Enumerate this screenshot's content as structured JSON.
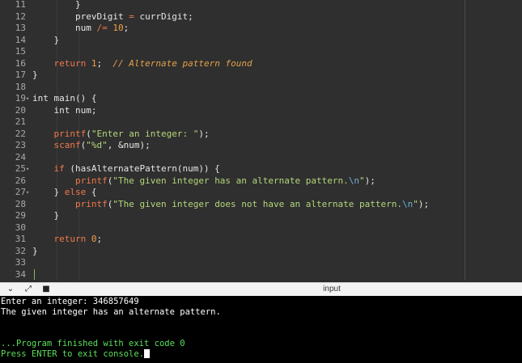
{
  "editor": {
    "line_numbers": [
      "11",
      "12",
      "13",
      "14",
      "15",
      "16",
      "17",
      "18",
      "19",
      "20",
      "21",
      "22",
      "23",
      "24",
      "25",
      "26",
      "27",
      "28",
      "29",
      "30",
      "31",
      "32",
      "33",
      "34"
    ],
    "folded_lines": [
      "19",
      "25",
      "27"
    ],
    "lines": [
      [
        {
          "t": "        }",
          "c": ""
        }
      ],
      [
        {
          "t": "        prevDigit ",
          "c": ""
        },
        {
          "t": "=",
          "c": "op"
        },
        {
          "t": " currDigit;",
          "c": ""
        }
      ],
      [
        {
          "t": "        num ",
          "c": ""
        },
        {
          "t": "/=",
          "c": "op"
        },
        {
          "t": " ",
          "c": ""
        },
        {
          "t": "10",
          "c": "num"
        },
        {
          "t": ";",
          "c": ""
        }
      ],
      [
        {
          "t": "    }",
          "c": ""
        }
      ],
      [
        {
          "t": "",
          "c": ""
        }
      ],
      [
        {
          "t": "    ",
          "c": ""
        },
        {
          "t": "return",
          "c": "fn"
        },
        {
          "t": " ",
          "c": ""
        },
        {
          "t": "1",
          "c": "num"
        },
        {
          "t": ";  ",
          "c": ""
        },
        {
          "t": "// Alternate pattern found",
          "c": "cmt"
        }
      ],
      [
        {
          "t": "}",
          "c": ""
        }
      ],
      [
        {
          "t": "",
          "c": ""
        }
      ],
      [
        {
          "t": "int main() {",
          "c": ""
        }
      ],
      [
        {
          "t": "    int num;",
          "c": ""
        }
      ],
      [
        {
          "t": "",
          "c": ""
        }
      ],
      [
        {
          "t": "    ",
          "c": ""
        },
        {
          "t": "printf",
          "c": "fn"
        },
        {
          "t": "(",
          "c": ""
        },
        {
          "t": "\"Enter an integer: \"",
          "c": "str"
        },
        {
          "t": ");",
          "c": ""
        }
      ],
      [
        {
          "t": "    ",
          "c": ""
        },
        {
          "t": "scanf",
          "c": "fn"
        },
        {
          "t": "(",
          "c": ""
        },
        {
          "t": "\"%d\"",
          "c": "str"
        },
        {
          "t": ", &num);",
          "c": ""
        }
      ],
      [
        {
          "t": "",
          "c": ""
        }
      ],
      [
        {
          "t": "    ",
          "c": ""
        },
        {
          "t": "if",
          "c": "fn"
        },
        {
          "t": " (hasAlternatePattern(num)) {",
          "c": ""
        }
      ],
      [
        {
          "t": "        ",
          "c": ""
        },
        {
          "t": "printf",
          "c": "fn"
        },
        {
          "t": "(",
          "c": ""
        },
        {
          "t": "\"The given integer has an alternate pattern.",
          "c": "str"
        },
        {
          "t": "\\n",
          "c": "esc"
        },
        {
          "t": "\"",
          "c": "str"
        },
        {
          "t": ");",
          "c": ""
        }
      ],
      [
        {
          "t": "    } ",
          "c": ""
        },
        {
          "t": "else",
          "c": "fn"
        },
        {
          "t": " {",
          "c": ""
        }
      ],
      [
        {
          "t": "        ",
          "c": ""
        },
        {
          "t": "printf",
          "c": "fn"
        },
        {
          "t": "(",
          "c": ""
        },
        {
          "t": "\"The given integer does not have an alternate pattern.",
          "c": "str"
        },
        {
          "t": "\\n",
          "c": "esc"
        },
        {
          "t": "\"",
          "c": "str"
        },
        {
          "t": ");",
          "c": ""
        }
      ],
      [
        {
          "t": "    }",
          "c": ""
        }
      ],
      [
        {
          "t": "",
          "c": ""
        }
      ],
      [
        {
          "t": "    ",
          "c": ""
        },
        {
          "t": "return",
          "c": "fn"
        },
        {
          "t": " ",
          "c": ""
        },
        {
          "t": "0",
          "c": "num"
        },
        {
          "t": ";",
          "c": ""
        }
      ],
      [
        {
          "t": "}",
          "c": ""
        }
      ],
      [
        {
          "t": "",
          "c": ""
        }
      ],
      [
        {
          "t": "",
          "c": ""
        }
      ]
    ]
  },
  "console_bar": {
    "title": "input",
    "icons": [
      "chevron-down-icon",
      "expand-icon",
      "stop-icon"
    ]
  },
  "console": {
    "lines": [
      {
        "text": "Enter an integer: 346857649",
        "green": false
      },
      {
        "text": "The given integer has an alternate pattern.",
        "green": false
      },
      {
        "text": "",
        "green": false
      },
      {
        "text": "",
        "green": false
      },
      {
        "text": "...Program finished with exit code 0",
        "green": true
      },
      {
        "text": "Press ENTER to exit console.",
        "green": true
      }
    ]
  },
  "colors": {
    "editor_bg": "#2f2f2f",
    "keyword": "#f0784a",
    "number": "#f0a04a",
    "string": "#b4d67a",
    "comment": "#e5a14a",
    "console_bg": "#000000",
    "console_green": "#5be05b"
  }
}
